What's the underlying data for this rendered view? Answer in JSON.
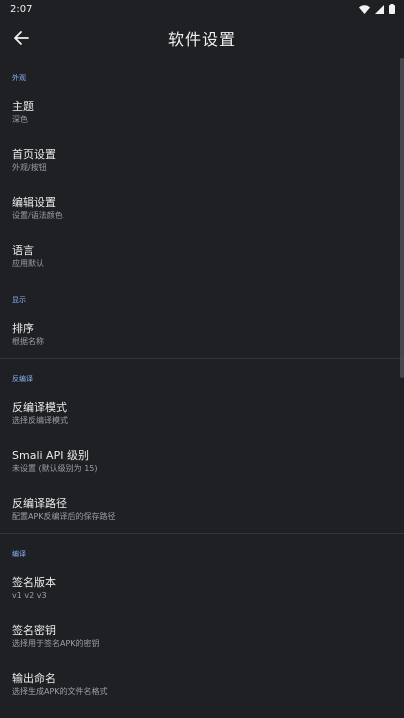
{
  "status_bar": {
    "time": "2:07",
    "icons": [
      "wifi-icon",
      "signal-icon",
      "battery-icon"
    ]
  },
  "app_bar": {
    "back_icon": "arrow-left-icon",
    "title": "软件设置"
  },
  "sections": [
    {
      "header": "外观",
      "items": [
        {
          "title": "主题",
          "subtitle": "深色"
        },
        {
          "title": "首页设置",
          "subtitle": "外观/按钮"
        },
        {
          "title": "编辑设置",
          "subtitle": "设置/语法颜色"
        },
        {
          "title": "语言",
          "subtitle": "应用默认"
        }
      ]
    },
    {
      "header": "显示",
      "items": [
        {
          "title": "排序",
          "subtitle": "根据名称"
        }
      ]
    },
    {
      "header": "反编译",
      "items": [
        {
          "title": "反编译模式",
          "subtitle": "选择反编译模式"
        },
        {
          "title": "Smali API 级别",
          "subtitle": "未设置 (默认级别为 15)"
        },
        {
          "title": "反编译路径",
          "subtitle": "配置APK反编译后的保存路径"
        }
      ]
    },
    {
      "header": "编译",
      "items": [
        {
          "title": "签名版本",
          "subtitle": "v1 v2 v3"
        },
        {
          "title": "签名密钥",
          "subtitle": "选择用于签名APK的密钥"
        },
        {
          "title": "输出命名",
          "subtitle": "选择生成APK的文件名格式"
        }
      ]
    }
  ],
  "colors": {
    "background": "#1f2024",
    "accent": "#8ab4f8",
    "title_text": "#ececec",
    "subtitle_text": "#9aa0a6"
  }
}
